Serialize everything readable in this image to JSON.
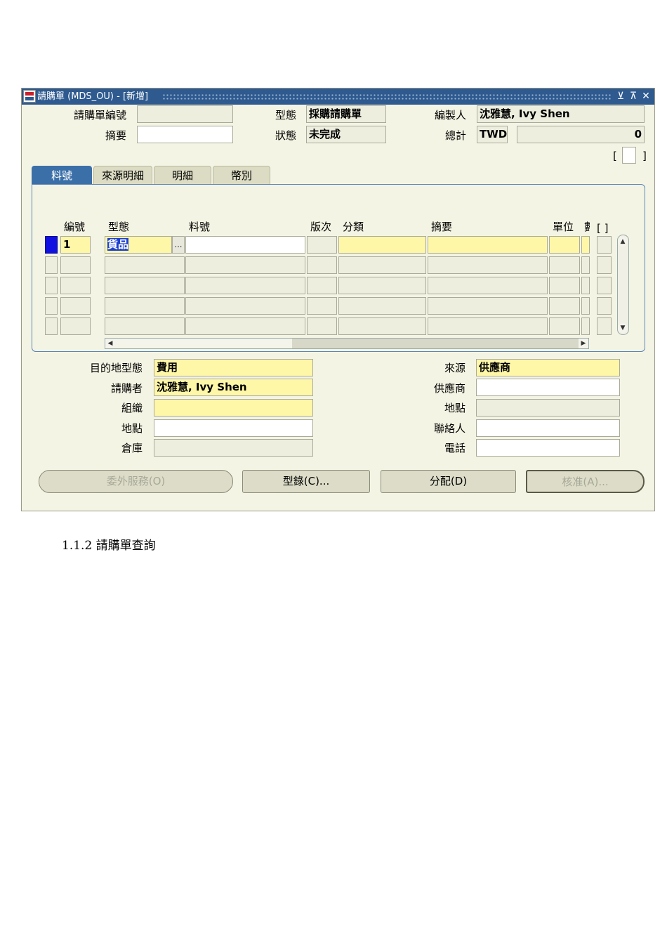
{
  "window": {
    "title": "請購單 (MDS_OU) - [新增]",
    "controls": {
      "minimize": "⊻",
      "maximize": "⊼",
      "close": "✕"
    }
  },
  "header": {
    "req_number": {
      "label": "請購單編號",
      "value": ""
    },
    "description": {
      "label": "摘要",
      "value": ""
    },
    "type": {
      "label": "型態",
      "value": "採購請購單"
    },
    "status": {
      "label": "狀態",
      "value": "未完成"
    },
    "preparer": {
      "label": "編製人",
      "value": "沈雅慧, Ivy Shen"
    },
    "total": {
      "label": "總計",
      "currency": "TWD",
      "value": "0"
    },
    "dff": {
      "open": "[",
      "close": "]"
    }
  },
  "tabs": [
    {
      "label": "料號",
      "active": true
    },
    {
      "label": "來源明細",
      "active": false
    },
    {
      "label": "明細",
      "active": false
    },
    {
      "label": "幣別",
      "active": false
    }
  ],
  "lines": {
    "columns": {
      "num": "編號",
      "type": "型態",
      "item": "料號",
      "rev": "版次",
      "category": "分類",
      "description": "摘要",
      "uom": "單位",
      "qty": "數",
      "dff": "[ ]"
    },
    "rows": [
      {
        "num": "1",
        "type": "貨品",
        "item": "",
        "rev": "",
        "category": "",
        "description": "",
        "uom": "",
        "qty": ""
      },
      {
        "num": "",
        "type": "",
        "item": "",
        "rev": "",
        "category": "",
        "description": "",
        "uom": "",
        "qty": ""
      },
      {
        "num": "",
        "type": "",
        "item": "",
        "rev": "",
        "category": "",
        "description": "",
        "uom": "",
        "qty": ""
      },
      {
        "num": "",
        "type": "",
        "item": "",
        "rev": "",
        "category": "",
        "description": "",
        "uom": "",
        "qty": ""
      },
      {
        "num": "",
        "type": "",
        "item": "",
        "rev": "",
        "category": "",
        "description": "",
        "uom": "",
        "qty": ""
      }
    ],
    "lov_button": "…"
  },
  "details": {
    "dest_type": {
      "label": "目的地型態",
      "value": "費用"
    },
    "requester": {
      "label": "請購者",
      "value": "沈雅慧, Ivy Shen"
    },
    "organization": {
      "label": "組織",
      "value": ""
    },
    "location": {
      "label": "地點",
      "value": ""
    },
    "subinventory": {
      "label": "倉庫",
      "value": ""
    },
    "source": {
      "label": "來源",
      "value": "供應商"
    },
    "supplier": {
      "label": "供應商",
      "value": ""
    },
    "site": {
      "label": "地點",
      "value": ""
    },
    "contact": {
      "label": "聯絡人",
      "value": ""
    },
    "phone": {
      "label": "電話",
      "value": ""
    }
  },
  "buttons": {
    "outside_services": "委外服務(O)",
    "catalog": "型錄(C)...",
    "distributions": "分配(D)",
    "approve": "核准(A)..."
  },
  "caption": "1.1.2 請購單查詢"
}
